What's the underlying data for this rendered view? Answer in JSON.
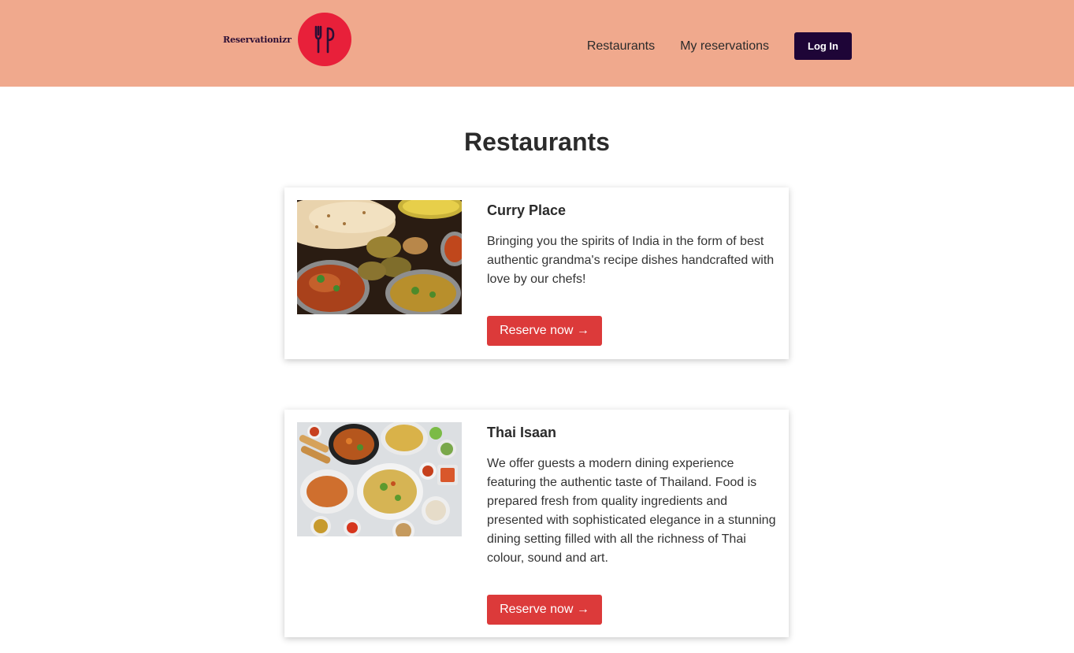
{
  "colors": {
    "header_bg": "#f0a98d",
    "logo_red": "#e8203a",
    "logo_dark": "#2c0f35",
    "login_bg": "#1e0537",
    "reserve_bg": "#dc3a3a"
  },
  "header": {
    "logo_text": "Reservationizr",
    "logo_icon": "fork-knife-icon",
    "nav": {
      "restaurants": "Restaurants",
      "my_reservations": "My reservations"
    },
    "login_label": "Log In"
  },
  "main": {
    "title": "Restaurants",
    "restaurants": [
      {
        "name": "Curry Place",
        "description": "Bringing you the spirits of India in the form of best authentic grandma's recipe dishes handcrafted with love by our chefs!",
        "button_label": "Reserve now →",
        "image": "indian-food-photo"
      },
      {
        "name": "Thai Isaan",
        "description": "We offer guests a modern dining experience featuring the authentic taste of Thailand. Food is prepared fresh from quality ingredients and presented with sophisticated elegance in a stunning dining setting filled with all the richness of Thai colour, sound and art.",
        "button_label": "Reserve now →",
        "image": "thai-food-photo"
      }
    ]
  }
}
